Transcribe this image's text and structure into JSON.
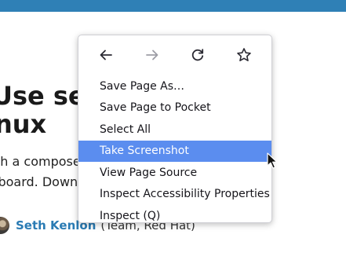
{
  "article": {
    "headline_line1": "Use sec                    eys on",
    "headline_line2": "inux",
    "intro_line1": "th a compose                                            s on your",
    "intro_line2": "yboard. Down",
    "author": "Seth Kenlon",
    "affiliation": "(Team, Red Hat)"
  },
  "context_menu": {
    "nav": {
      "back_icon": "arrow-left-icon",
      "forward_icon": "arrow-right-icon",
      "reload_icon": "reload-icon",
      "bookmark_icon": "star-icon"
    },
    "items": [
      {
        "label": "Save Page As…"
      },
      {
        "label": "Save Page to Pocket"
      },
      {
        "label": "Select All"
      },
      {
        "label": "Take Screenshot"
      },
      {
        "label": "View Page Source"
      },
      {
        "label": "Inspect Accessibility Properties"
      },
      {
        "label": "Inspect (Q)"
      }
    ],
    "highlight_color": "#5b8def"
  },
  "colors": {
    "top_bar": "#2f80b6",
    "author_link": "#2a7bb4"
  }
}
